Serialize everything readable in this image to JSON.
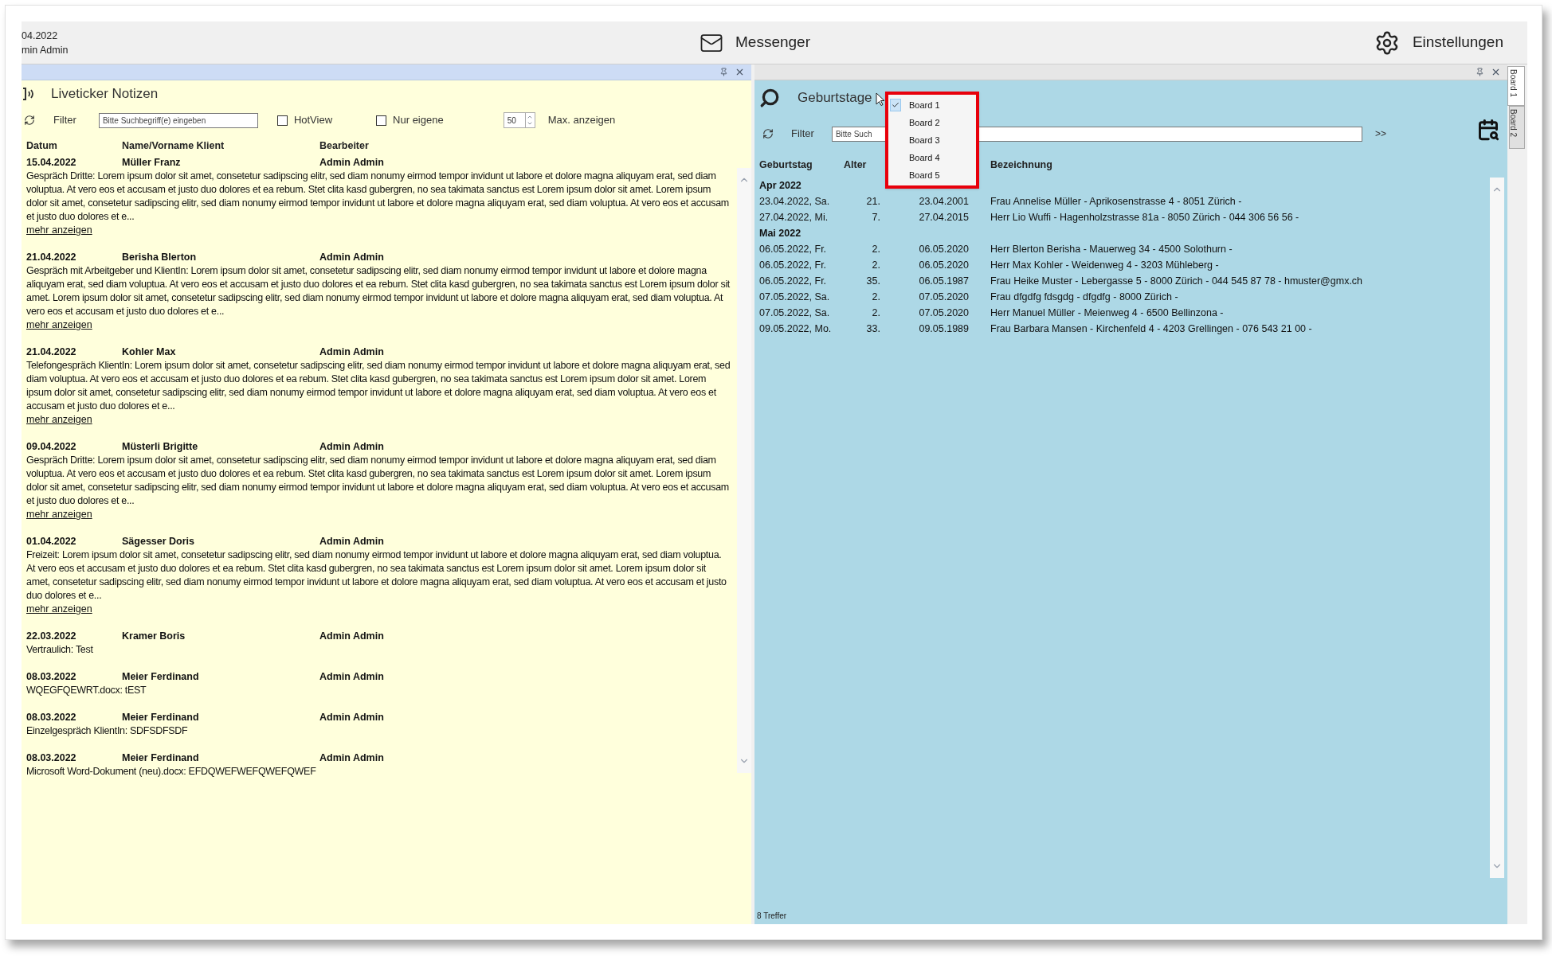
{
  "header": {
    "date": "04.2022",
    "user": "min Admin",
    "messenger": "Messenger",
    "settings": "Einstellungen"
  },
  "left_panel": {
    "title": "Liveticker Notizen",
    "filter_label": "Filter",
    "search": {
      "placeholder": "Bitte Suchbegriff(e) eingeben"
    },
    "checkboxes": [
      {
        "label": "HotView",
        "checked": false
      },
      {
        "label": "Nur eigene",
        "checked": false
      }
    ],
    "max": {
      "value": "50",
      "label": "Max. anzeigen"
    },
    "columns": [
      "Datum",
      "Name/Vorname Klient",
      "Bearbeiter"
    ],
    "entries": [
      {
        "date": "15.04.2022",
        "name": "Müller Franz",
        "editor": "Admin Admin",
        "text": "Gespräch Dritte: Lorem ipsum dolor sit amet, consetetur sadipscing elitr, sed diam nonumy eirmod tempor invidunt ut labore et dolore magna aliquyam erat, sed diam voluptua. At vero eos et accusam et justo duo dolores et ea rebum. Stet clita kasd gubergren, no sea takimata sanctus est Lorem ipsum dolor sit amet. Lorem ipsum dolor sit amet, consetetur sadipscing elitr, sed diam nonumy eirmod tempor invidunt ut labore et dolore magna aliquyam erat, sed diam voluptua. At vero eos et accusam et justo duo dolores et e...",
        "more": "mehr anzeigen"
      },
      {
        "date": "21.04.2022",
        "name": "Berisha Blerton",
        "editor": "Admin Admin",
        "text": "Gespräch mit Arbeitgeber und KlientIn: Lorem ipsum dolor sit amet, consetetur sadipscing elitr, sed diam nonumy eirmod tempor invidunt ut labore et dolore magna aliquyam erat, sed diam voluptua. At vero eos et accusam et justo duo dolores et ea rebum. Stet clita kasd gubergren, no sea takimata sanctus est Lorem ipsum dolor sit amet. Lorem ipsum dolor sit amet, consetetur sadipscing elitr, sed diam nonumy eirmod tempor invidunt ut labore et dolore magna aliquyam erat, sed diam voluptua. At vero eos et accusam et justo duo dolores et e...",
        "more": "mehr anzeigen"
      },
      {
        "date": "21.04.2022",
        "name": "Kohler Max",
        "editor": "Admin Admin",
        "text": "Telefongespräch KlientIn: Lorem ipsum dolor sit amet, consetetur sadipscing elitr, sed diam nonumy eirmod tempor invidunt ut labore et dolore magna aliquyam erat, sed diam voluptua. At vero eos et accusam et justo duo dolores et ea rebum. Stet clita kasd gubergren, no sea takimata sanctus est Lorem ipsum dolor sit amet. Lorem ipsum dolor sit amet, consetetur sadipscing elitr, sed diam nonumy eirmod tempor invidunt ut labore et dolore magna aliquyam erat, sed diam voluptua. At vero eos et accusam et justo duo dolores et e...",
        "more": "mehr anzeigen"
      },
      {
        "date": "09.04.2022",
        "name": "Müsterli Brigitte",
        "editor": "Admin Admin",
        "text": "Gespräch Dritte: Lorem ipsum dolor sit amet, consetetur sadipscing elitr, sed diam nonumy eirmod tempor invidunt ut labore et dolore magna aliquyam erat, sed diam voluptua. At vero eos et accusam et justo duo dolores et ea rebum. Stet clita kasd gubergren, no sea takimata sanctus est Lorem ipsum dolor sit amet. Lorem ipsum dolor sit amet, consetetur sadipscing elitr, sed diam nonumy eirmod tempor invidunt ut labore et dolore magna aliquyam erat, sed diam voluptua. At vero eos et accusam et justo duo dolores et e...",
        "more": "mehr anzeigen"
      },
      {
        "date": "01.04.2022",
        "name": "Sägesser Doris",
        "editor": "Admin Admin",
        "text": "Freizeit: Lorem ipsum dolor sit amet, consetetur sadipscing elitr, sed diam nonumy eirmod tempor invidunt ut labore et dolore magna aliquyam erat, sed diam voluptua. At vero eos et accusam et justo duo dolores et ea rebum. Stet clita kasd gubergren, no sea takimata sanctus est Lorem ipsum dolor sit amet. Lorem ipsum dolor sit amet, consetetur sadipscing elitr, sed diam nonumy eirmod tempor invidunt ut labore et dolore magna aliquyam erat, sed diam voluptua. At vero eos et accusam et justo duo dolores et e...",
        "more": "mehr anzeigen"
      },
      {
        "date": "22.03.2022",
        "name": "Kramer Boris",
        "editor": "Admin Admin",
        "text": "Vertraulich: Test"
      },
      {
        "date": "08.03.2022",
        "name": "Meier Ferdinand",
        "editor": "Admin Admin",
        "text": "WQEGFQEWRT.docx: tEST"
      },
      {
        "date": "08.03.2022",
        "name": "Meier Ferdinand",
        "editor": "Admin Admin",
        "text": "Einzelgespräch KlientIn: SDFSDFSDF"
      },
      {
        "date": "08.03.2022",
        "name": "Meier Ferdinand",
        "editor": "Admin Admin",
        "text": "Microsoft Word-Dokument (neu).docx: EFDQWEFWEFQWEFQWEF"
      }
    ]
  },
  "right_panel": {
    "title": "Geburtstage",
    "menu": [
      {
        "label": "Board 1",
        "selected": true
      },
      {
        "label": "Board 2",
        "selected": false
      },
      {
        "label": "Board 3",
        "selected": false
      },
      {
        "label": "Board 4",
        "selected": false
      },
      {
        "label": "Board 5",
        "selected": false
      }
    ],
    "filter_label": "Filter",
    "search": {
      "placeholder": "Bitte Such"
    },
    "more": ">>",
    "columns": [
      "Geburtstag",
      "Alter",
      "Bezeichnung"
    ],
    "groups": [
      {
        "month": "Apr 2022",
        "rows": [
          [
            "23.04.2022, Sa.",
            "21.",
            "23.04.2001",
            "Frau Annelise Müller - Aprikosenstrasse 4 - 8051 Zürich -"
          ],
          [
            "27.04.2022, Mi.",
            "7.",
            "27.04.2015",
            "Herr Lio Wuffi - Hagenholzstrasse 81a - 8050 Zürich - 044 306 56 56 -"
          ]
        ]
      },
      {
        "month": "Mai 2022",
        "rows": [
          [
            "06.05.2022, Fr.",
            "2.",
            "06.05.2020",
            "Herr Blerton Berisha - Mauerweg 34 - 4500 Solothurn -"
          ],
          [
            "06.05.2022, Fr.",
            "2.",
            "06.05.2020",
            "Herr Max Kohler - Weidenweg 4 - 3203 Mühleberg -"
          ],
          [
            "06.05.2022, Fr.",
            "35.",
            "06.05.1987",
            "Frau Heike Muster - Lebergasse 5 - 8000 Zürich - 044 545 87 78 - hmuster@gmx.ch"
          ],
          [
            "07.05.2022, Sa.",
            "2.",
            "07.05.2020",
            "Frau dfgdfg fdsgdg - dfgdfg - 8000 Zürich -"
          ],
          [
            "07.05.2022, Sa.",
            "2.",
            "07.05.2020",
            "Herr Manuel Müller - Meienweg 4 - 6500 Bellinzona -"
          ],
          [
            "09.05.2022, Mo.",
            "33.",
            "09.05.1989",
            "Frau Barbara Mansen - Kirchenfeld 4 - 4203 Grellingen - 076 543 21 00 -"
          ]
        ]
      }
    ],
    "count": "8 Treffer"
  },
  "side_tabs": [
    {
      "label": "Board 1",
      "selected": true
    },
    {
      "label": "Board 2",
      "selected": false
    }
  ]
}
